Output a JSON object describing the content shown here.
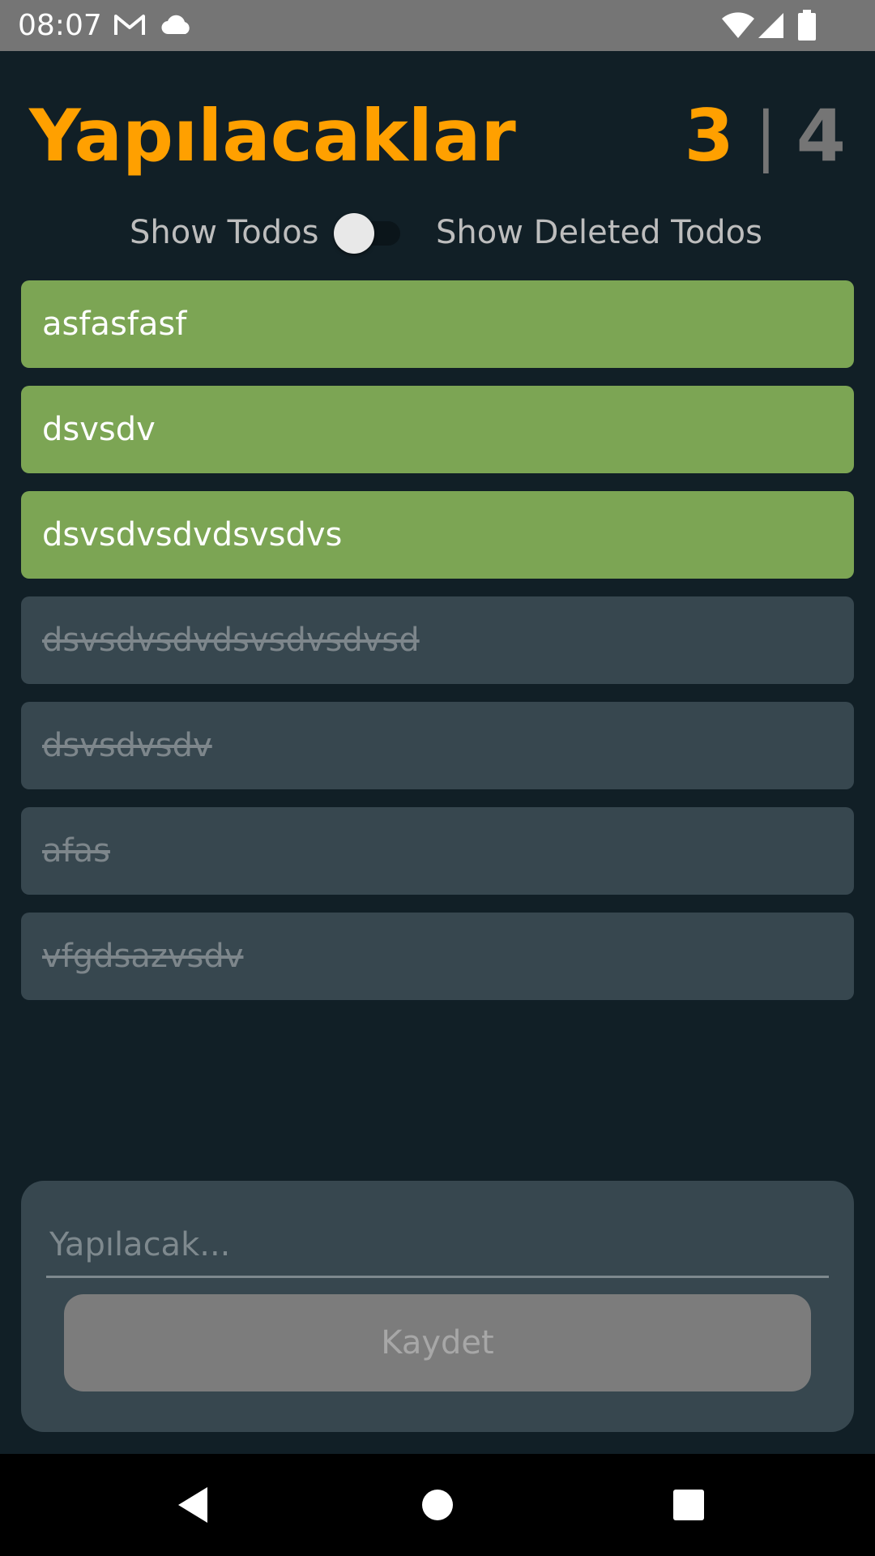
{
  "status_bar": {
    "time": "08:07",
    "icons": [
      "gmail-icon",
      "cloud-icon",
      "wifi-icon",
      "signal-icon",
      "battery-icon"
    ]
  },
  "header": {
    "title": "Yapılacaklar",
    "active_count": "3",
    "separator": "|",
    "done_count": "4"
  },
  "toggle": {
    "left_label": "Show Todos",
    "right_label": "Show Deleted Todos",
    "state": "off"
  },
  "todos": [
    {
      "text": "asfasfasf",
      "status": "active"
    },
    {
      "text": "dsvsdv",
      "status": "active"
    },
    {
      "text": "dsvsdvsdvdsvsdvs",
      "status": "active"
    },
    {
      "text": "dsvsdvsdvdsvsdvsdvsd",
      "status": "done"
    },
    {
      "text": "dsvsdvsdv",
      "status": "done"
    },
    {
      "text": "afas",
      "status": "done"
    },
    {
      "text": "vfgdsazvsdv",
      "status": "done"
    }
  ],
  "form": {
    "input_placeholder": "Yapılacak...",
    "input_value": "",
    "save_label": "Kaydet"
  },
  "nav": {
    "icons": [
      "back-icon",
      "home-icon",
      "recents-icon"
    ]
  },
  "colors": {
    "background": "#111f26",
    "accent": "#ffa000",
    "active_item": "#7ca554",
    "done_item": "#37474f",
    "done_count": "#757575"
  }
}
